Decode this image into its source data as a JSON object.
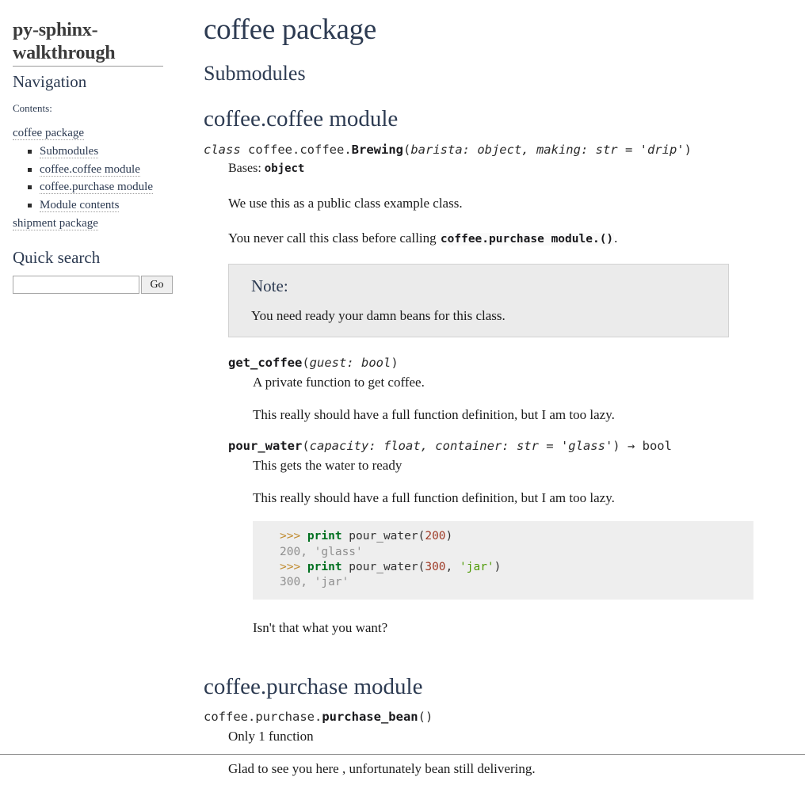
{
  "sidebar": {
    "site_title": "py-sphinx-walkthrough",
    "navigation_heading": "Navigation",
    "contents_label": "Contents:",
    "toc": [
      {
        "label": "coffee package",
        "children": [
          {
            "label": "Submodules"
          },
          {
            "label": "coffee.coffee module"
          },
          {
            "label": "coffee.purchase module"
          },
          {
            "label": "Module contents"
          }
        ]
      },
      {
        "label": "shipment package",
        "children": []
      }
    ],
    "quick_search": {
      "heading": "Quick search",
      "input_value": "",
      "placeholder": "",
      "button_label": "Go"
    }
  },
  "content": {
    "page_title": "coffee package",
    "submodules_heading": "Submodules",
    "coffee_module": {
      "heading": "coffee.coffee module",
      "class_sig": {
        "keyword": "class ",
        "prefix": "coffee.coffee.",
        "name": "Brewing",
        "open_paren": "(",
        "params": "barista: object, making: str = 'drip'",
        "close_paren": ")"
      },
      "bases_label": "Bases: ",
      "bases_value": "object",
      "paragraph_1": "We use this as a public class example class.",
      "paragraph_2_pre": "You never call this class before calling ",
      "paragraph_2_code": "coffee.purchase module.()",
      "paragraph_2_post": ".",
      "note": {
        "title": "Note:",
        "body": "You need ready your damn beans for this class."
      },
      "methods": [
        {
          "name": "get_coffee",
          "open_paren": "(",
          "params": "guest: bool",
          "close_paren": ")",
          "returns": "",
          "desc_1": "A private function to get coffee.",
          "desc_2": "This really should have a full function definition, but I am too lazy."
        },
        {
          "name": "pour_water",
          "open_paren": "(",
          "params": "capacity: float, container: str = 'glass'",
          "close_paren": ")",
          "returns": " → bool",
          "desc_1": "This gets the water to ready",
          "desc_2": "This really should have a full function definition, but I am too lazy."
        }
      ],
      "code_example": {
        "lines": [
          {
            "prompt": ">>> ",
            "kw": "print",
            "fn": " pour_water",
            "pn_open": "(",
            "num": "200",
            "pn_close": ")"
          },
          {
            "out": "200, 'glass'"
          },
          {
            "prompt": ">>> ",
            "kw": "print",
            "fn": " pour_water",
            "pn_open": "(",
            "num": "300",
            "sep": ", ",
            "str": "'jar'",
            "pn_close": ")"
          },
          {
            "out": "300, 'jar'"
          }
        ]
      },
      "closing_paragraph": "Isn't that what you want?"
    },
    "purchase_module": {
      "heading": "coffee.purchase module",
      "function_sig": {
        "prefix": "coffee.purchase.",
        "name": "purchase_bean",
        "open_paren": "(",
        "params": "",
        "close_paren": ")"
      },
      "desc_1": "Only 1 function",
      "desc_2": "Glad to see you here , unfortunately bean still delivering."
    }
  },
  "colors": {
    "heading": "#2d3b52",
    "link": "#2d3b52",
    "note_bg": "#ebebeb",
    "code_bg": "#eeeeee",
    "prompt": "#c08b2f",
    "keyword": "#007020",
    "number": "#9e3a26",
    "string": "#4e9a06",
    "output": "#8f8f8f"
  }
}
